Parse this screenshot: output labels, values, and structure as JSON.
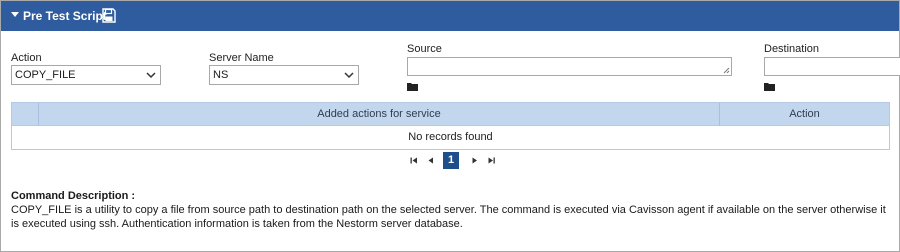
{
  "header": {
    "title": "Pre Test Script"
  },
  "form": {
    "action_label": "Action",
    "action_value": "COPY_FILE",
    "server_label": "Server Name",
    "server_value": "NS",
    "source_label": "Source",
    "source_value": "",
    "destination_label": "Destination",
    "destination_value": ""
  },
  "grid": {
    "columns": [
      "",
      "Added actions for service",
      "Action"
    ],
    "empty_message": "No records found"
  },
  "pager": {
    "current_page": "1"
  },
  "description": {
    "title": "Command Description :",
    "text": "COPY_FILE is a utility to copy a file from source path to destination path on the selected server. The command is executed via Cavisson agent if available on the server otherwise it is executed using ssh. Authentication information is taken from the Nestorm server database."
  },
  "colors": {
    "header_bg": "#2e5c9e",
    "grid_head_bg": "#c2d7ee",
    "pager_active": "#1f4f8a"
  }
}
